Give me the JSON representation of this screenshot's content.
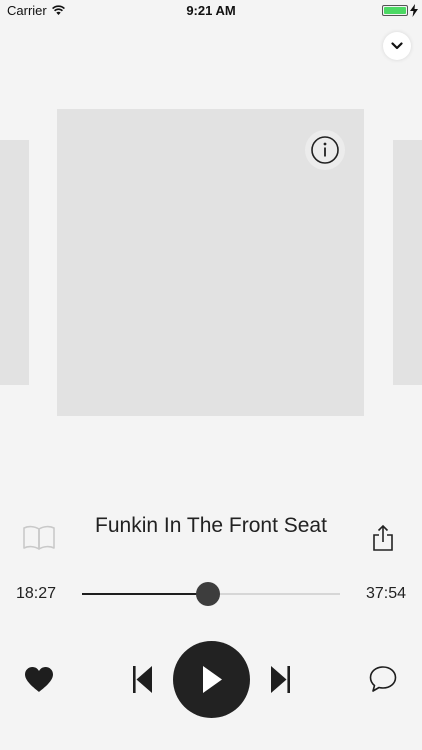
{
  "status_bar": {
    "carrier": "Carrier",
    "time": "9:21 AM",
    "battery_level": 1.0
  },
  "header": {
    "collapse_icon": "chevron-down-icon"
  },
  "artwork": {
    "info_icon": "info-icon"
  },
  "track": {
    "title": "Funkin In The Front Seat"
  },
  "progress": {
    "elapsed": "18:27",
    "duration": "37:54",
    "fraction": 0.487
  },
  "icons": {
    "chapters": "book-icon",
    "share": "share-icon",
    "favorite": "heart-icon",
    "previous": "skip-previous-icon",
    "play": "play-icon",
    "next": "skip-next-icon",
    "comments": "comment-icon"
  },
  "colors": {
    "background": "#f4f4f4",
    "placeholder": "#e2e2e2",
    "control_dark": "#222222",
    "battery": "#4cd964"
  }
}
